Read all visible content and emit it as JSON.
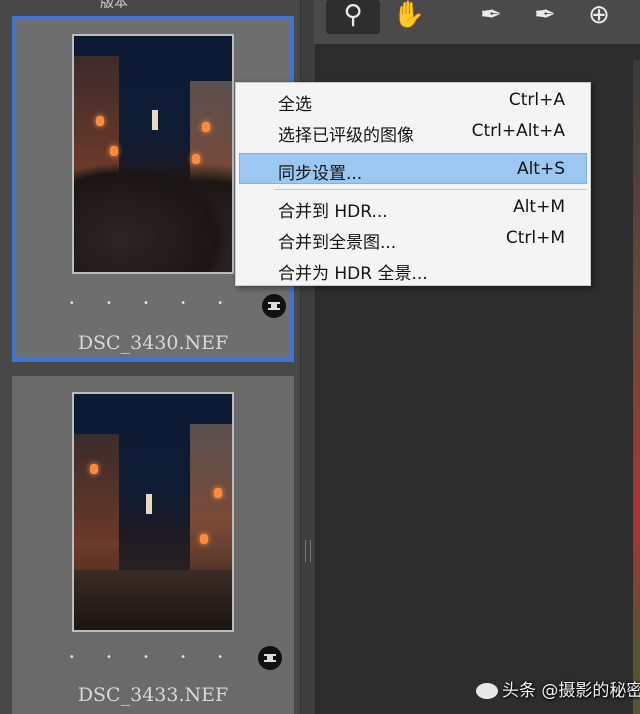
{
  "filmstrip": {
    "top_label": "版本",
    "thumbnails": [
      {
        "filename": "DSC_3430.NEF",
        "rating": "• • • • •",
        "selected": true
      },
      {
        "filename": "DSC_3433.NEF",
        "rating": "• • • • •",
        "selected": false
      }
    ]
  },
  "toolbar": {
    "tools": [
      {
        "icon": "zoom-icon",
        "glyph": "🔍",
        "active": true
      },
      {
        "icon": "hand-icon",
        "glyph": "✋",
        "active": false
      },
      {
        "icon": "eyedropper-icon",
        "glyph": "✎",
        "active": false
      },
      {
        "icon": "eyedropper-plus-icon",
        "glyph": "✎",
        "active": false
      },
      {
        "icon": "target-sample-icon",
        "glyph": "⊕",
        "active": false
      }
    ]
  },
  "context_menu": {
    "items": [
      {
        "label": "全选",
        "shortcut": "Ctrl+A",
        "highlighted": false
      },
      {
        "label": "选择已评级的图像",
        "shortcut": "Ctrl+Alt+A",
        "highlighted": false
      },
      {
        "label": "同步设置...",
        "shortcut": "Alt+S",
        "highlighted": true
      },
      {
        "label": "合并到 HDR...",
        "shortcut": "Alt+M",
        "highlighted": false
      },
      {
        "label": "合并到全景图...",
        "shortcut": "Ctrl+M",
        "highlighted": false
      },
      {
        "label": "合并为 HDR 全景...",
        "shortcut": "",
        "highlighted": false
      }
    ]
  },
  "watermark": {
    "text": "头条 @摄影的秘密"
  },
  "colors": {
    "selection_border": "#3e74d4",
    "menu_highlight": "#9cc7f0"
  }
}
